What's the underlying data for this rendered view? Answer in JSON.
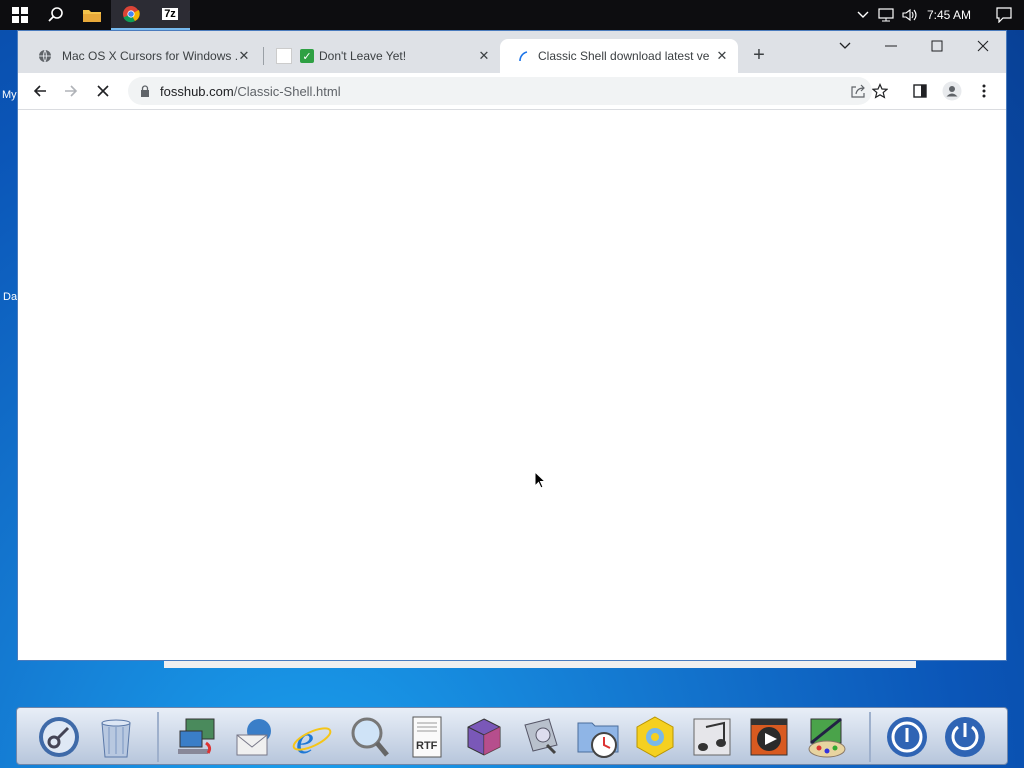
{
  "taskbar": {
    "clock": "7:45 AM",
    "icons": [
      "windows-start-icon",
      "search-icon",
      "file-explorer-icon",
      "chrome-icon",
      "7zip-icon"
    ],
    "seven_zip_label": "7z"
  },
  "desktop": {
    "label_my": "My",
    "label_da": "Da"
  },
  "browser": {
    "tabs": [
      {
        "title": "Mac OS X Cursors for Windows ...",
        "active": false
      },
      {
        "title": "Don't Leave Yet!",
        "active": false
      },
      {
        "title": "Classic Shell download latest ver...",
        "active": true
      }
    ],
    "new_tab_label": "+",
    "address": {
      "host": "fosshub.com",
      "path": "/Classic-Shell.html"
    }
  },
  "dock": {
    "items": [
      "key-icon",
      "trash-icon",
      "network-computer-icon",
      "mail-icon",
      "internet-explorer-icon",
      "magnifier-icon",
      "rtf-document-icon",
      "cube-app-icon",
      "disk-utility-icon",
      "clock-folder-icon",
      "settings-hexagon-icon",
      "music-icon",
      "video-player-icon",
      "paint-icon",
      "power-icon",
      "shutdown-icon"
    ]
  },
  "colors": {
    "accent": "#1a73e8",
    "tabstrip": "#dee1e6",
    "taskbar": "#0d0d10"
  }
}
